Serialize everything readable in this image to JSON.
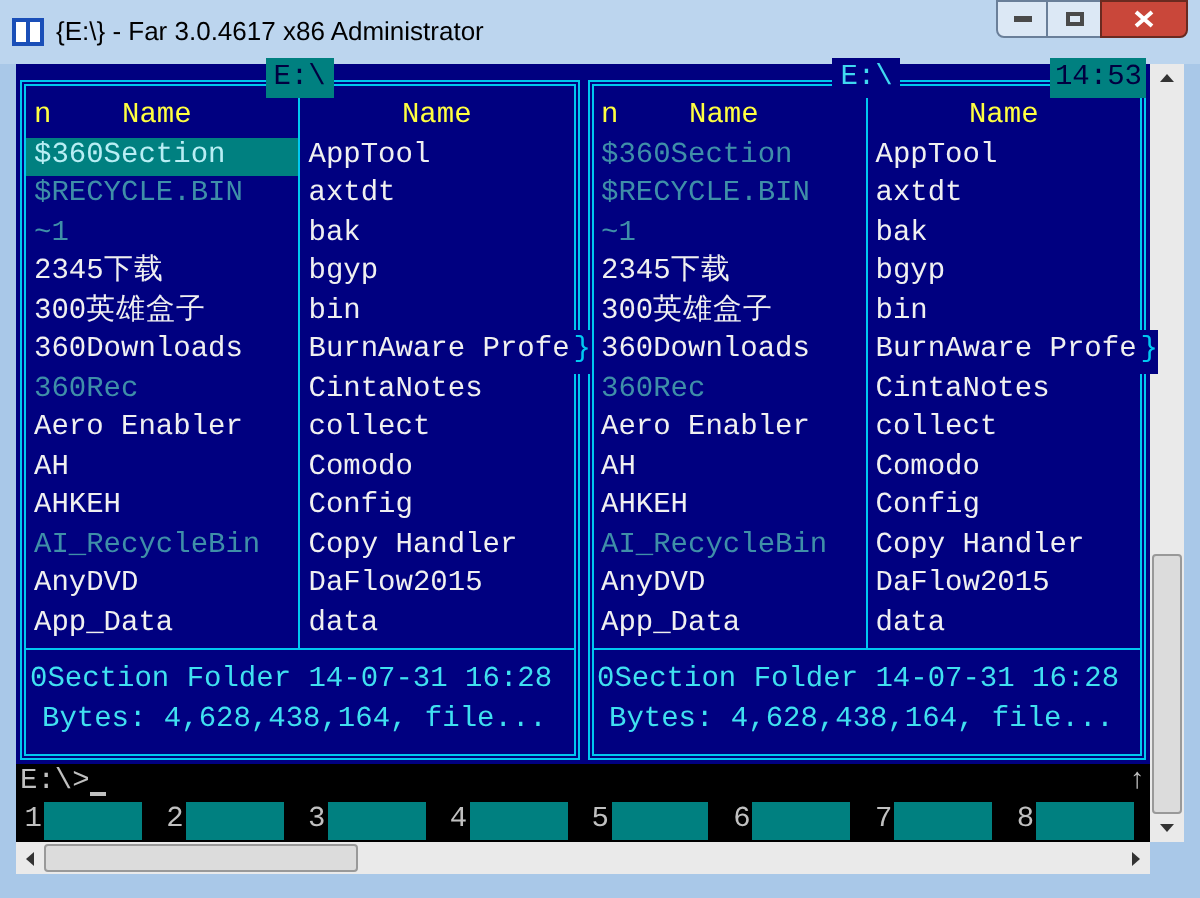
{
  "window": {
    "title": "{E:\\} - Far 3.0.4617 x86 Administrator"
  },
  "panels": [
    {
      "title": "E:\\",
      "active": true,
      "columns": [
        {
          "sort_mark": "n",
          "heading": "Name",
          "files": [
            {
              "name": "$360Section",
              "hidden": true,
              "selected": true
            },
            {
              "name": "$RECYCLE.BIN",
              "hidden": true,
              "selected": false
            },
            {
              "name": "~1",
              "hidden": true,
              "selected": false
            },
            {
              "name": "2345下载",
              "hidden": false,
              "selected": false
            },
            {
              "name": "300英雄盒子",
              "hidden": false,
              "selected": false
            },
            {
              "name": "360Downloads",
              "hidden": false,
              "selected": false
            },
            {
              "name": "360Rec",
              "hidden": true,
              "selected": false
            },
            {
              "name": "Aero Enabler",
              "hidden": false,
              "selected": false
            },
            {
              "name": "AH",
              "hidden": false,
              "selected": false
            },
            {
              "name": "AHKEH",
              "hidden": false,
              "selected": false
            },
            {
              "name": "AI_RecycleBin",
              "hidden": true,
              "selected": false
            },
            {
              "name": "AnyDVD",
              "hidden": false,
              "selected": false
            },
            {
              "name": "App_Data",
              "hidden": false,
              "selected": false
            }
          ]
        },
        {
          "heading": "Name",
          "files": [
            {
              "name": "AppTool",
              "hidden": false,
              "selected": false
            },
            {
              "name": "axtdt",
              "hidden": false,
              "selected": false
            },
            {
              "name": "bak",
              "hidden": false,
              "selected": false
            },
            {
              "name": "bgyp",
              "hidden": false,
              "selected": false
            },
            {
              "name": "bin",
              "hidden": false,
              "selected": false
            },
            {
              "name": "BurnAware Profe",
              "hidden": false,
              "selected": false,
              "overflow_mark": "}"
            },
            {
              "name": "CintaNotes",
              "hidden": false,
              "selected": false
            },
            {
              "name": "collect",
              "hidden": false,
              "selected": false
            },
            {
              "name": "Comodo",
              "hidden": false,
              "selected": false
            },
            {
              "name": "Config",
              "hidden": false,
              "selected": false
            },
            {
              "name": "Copy Handler",
              "hidden": false,
              "selected": false
            },
            {
              "name": "DaFlow2015",
              "hidden": false,
              "selected": false
            },
            {
              "name": "data",
              "hidden": false,
              "selected": false
            }
          ]
        }
      ],
      "info": "0Section Folder 14-07-31 16:28",
      "summary": "Bytes: 4,628,438,164, file..."
    },
    {
      "title": "E:\\",
      "active": false,
      "clock": "14:53",
      "columns": [
        {
          "sort_mark": "n",
          "heading": "Name",
          "files": [
            {
              "name": "$360Section",
              "hidden": true,
              "selected": false
            },
            {
              "name": "$RECYCLE.BIN",
              "hidden": true,
              "selected": false
            },
            {
              "name": "~1",
              "hidden": true,
              "selected": false
            },
            {
              "name": "2345下载",
              "hidden": false,
              "selected": false
            },
            {
              "name": "300英雄盒子",
              "hidden": false,
              "selected": false
            },
            {
              "name": "360Downloads",
              "hidden": false,
              "selected": false
            },
            {
              "name": "360Rec",
              "hidden": true,
              "selected": false
            },
            {
              "name": "Aero Enabler",
              "hidden": false,
              "selected": false
            },
            {
              "name": "AH",
              "hidden": false,
              "selected": false
            },
            {
              "name": "AHKEH",
              "hidden": false,
              "selected": false
            },
            {
              "name": "AI_RecycleBin",
              "hidden": true,
              "selected": false
            },
            {
              "name": "AnyDVD",
              "hidden": false,
              "selected": false
            },
            {
              "name": "App_Data",
              "hidden": false,
              "selected": false
            }
          ]
        },
        {
          "heading": "Name",
          "files": [
            {
              "name": "AppTool",
              "hidden": false,
              "selected": false
            },
            {
              "name": "axtdt",
              "hidden": false,
              "selected": false
            },
            {
              "name": "bak",
              "hidden": false,
              "selected": false
            },
            {
              "name": "bgyp",
              "hidden": false,
              "selected": false
            },
            {
              "name": "bin",
              "hidden": false,
              "selected": false
            },
            {
              "name": "BurnAware Profe",
              "hidden": false,
              "selected": false,
              "overflow_mark": "}"
            },
            {
              "name": "CintaNotes",
              "hidden": false,
              "selected": false
            },
            {
              "name": "collect",
              "hidden": false,
              "selected": false
            },
            {
              "name": "Comodo",
              "hidden": false,
              "selected": false
            },
            {
              "name": "Config",
              "hidden": false,
              "selected": false
            },
            {
              "name": "Copy Handler",
              "hidden": false,
              "selected": false
            },
            {
              "name": "DaFlow2015",
              "hidden": false,
              "selected": false
            },
            {
              "name": "data",
              "hidden": false,
              "selected": false
            }
          ]
        }
      ],
      "info": "0Section Folder 14-07-31 16:28",
      "summary": "Bytes: 4,628,438,164, file..."
    }
  ],
  "command_line": {
    "prompt": "E:\\>",
    "history_mark": "↑"
  },
  "keybar": [
    {
      "number": "1"
    },
    {
      "number": "2"
    },
    {
      "number": "3"
    },
    {
      "number": "4"
    },
    {
      "number": "5"
    },
    {
      "number": "6"
    },
    {
      "number": "7"
    },
    {
      "number": "8"
    }
  ]
}
